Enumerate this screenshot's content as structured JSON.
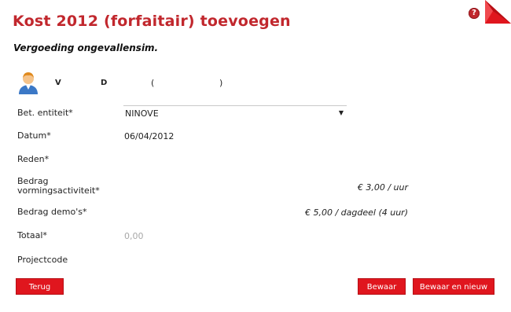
{
  "header": {
    "title": "Kost 2012 (forfaitair) toevoegen",
    "subtitle": "Vergoeding ongevallensim.",
    "help_glyph": "?"
  },
  "user": {
    "avatar_icon": "user-avatar-icon",
    "first": "V",
    "last": "D",
    "paren_open": "(",
    "paren_close": ")"
  },
  "form": {
    "entity_label": "Bet. entiteit*",
    "entity_value": "NINOVE",
    "date_label": "Datum*",
    "date_value": "06/04/2012",
    "reason_label": "Reden*",
    "amount_activity_label_1": "Bedrag",
    "amount_activity_label_2": "vormingsactiviteit*",
    "amount_activity_rate": "€ 3,00 / uur",
    "amount_demo_label": "Bedrag demo's*",
    "amount_demo_rate": "€ 5,00 / dagdeel (4 uur)",
    "total_label": "Totaal*",
    "total_value": "0,00",
    "project_label": "Projectcode"
  },
  "buttons": {
    "back": "Terug",
    "save": "Bewaar",
    "save_new": "Bewaar en nieuw"
  },
  "colors": {
    "accent": "#c1272d",
    "button": "#e0161e"
  }
}
